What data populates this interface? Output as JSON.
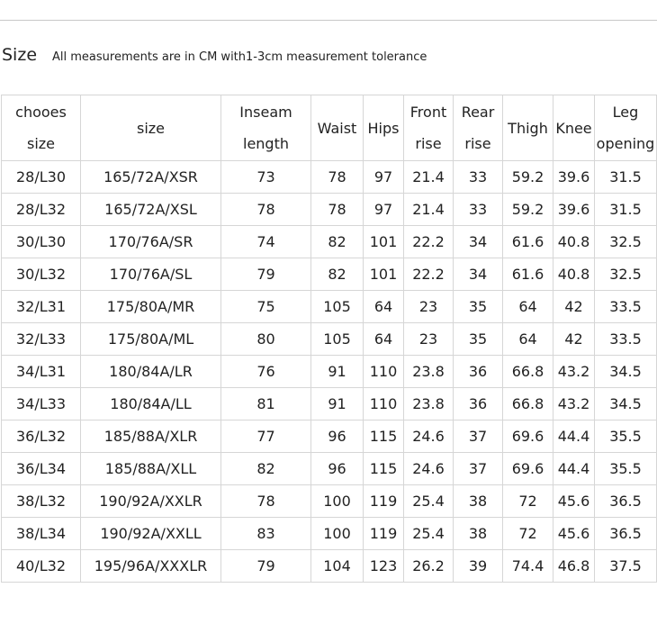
{
  "heading": {
    "title": "Size",
    "note": "All measurements are in CM with1-3cm measurement tolerance"
  },
  "table": {
    "headers": [
      {
        "lines": [
          "chooes",
          "size"
        ]
      },
      {
        "lines": [
          "size"
        ]
      },
      {
        "lines": [
          "Inseam",
          "length"
        ]
      },
      {
        "lines": [
          "Waist"
        ]
      },
      {
        "lines": [
          "Hips"
        ]
      },
      {
        "lines": [
          "Front",
          "rise"
        ]
      },
      {
        "lines": [
          "Rear",
          "rise"
        ]
      },
      {
        "lines": [
          "Thigh"
        ]
      },
      {
        "lines": [
          "Knee"
        ]
      },
      {
        "lines": [
          "Leg",
          "opening"
        ]
      }
    ],
    "rows": [
      [
        "28/L30",
        "165/72A/XSR",
        "73",
        "78",
        "97",
        "21.4",
        "33",
        "59.2",
        "39.6",
        "31.5"
      ],
      [
        "28/L32",
        "165/72A/XSL",
        "78",
        "78",
        "97",
        "21.4",
        "33",
        "59.2",
        "39.6",
        "31.5"
      ],
      [
        "30/L30",
        "170/76A/SR",
        "74",
        "82",
        "101",
        "22.2",
        "34",
        "61.6",
        "40.8",
        "32.5"
      ],
      [
        "30/L32",
        "170/76A/SL",
        "79",
        "82",
        "101",
        "22.2",
        "34",
        "61.6",
        "40.8",
        "32.5"
      ],
      [
        "32/L31",
        "175/80A/MR",
        "75",
        "105",
        "64",
        "23",
        "35",
        "64",
        "42",
        "33.5"
      ],
      [
        "32/L33",
        "175/80A/ML",
        "80",
        "105",
        "64",
        "23",
        "35",
        "64",
        "42",
        "33.5"
      ],
      [
        "34/L31",
        "180/84A/LR",
        "76",
        "91",
        "110",
        "23.8",
        "36",
        "66.8",
        "43.2",
        "34.5"
      ],
      [
        "34/L33",
        "180/84A/LL",
        "81",
        "91",
        "110",
        "23.8",
        "36",
        "66.8",
        "43.2",
        "34.5"
      ],
      [
        "36/L32",
        "185/88A/XLR",
        "77",
        "96",
        "115",
        "24.6",
        "37",
        "69.6",
        "44.4",
        "35.5"
      ],
      [
        "36/L34",
        "185/88A/XLL",
        "82",
        "96",
        "115",
        "24.6",
        "37",
        "69.6",
        "44.4",
        "35.5"
      ],
      [
        "38/L32",
        "190/92A/XXLR",
        "78",
        "100",
        "119",
        "25.4",
        "38",
        "72",
        "45.6",
        "36.5"
      ],
      [
        "38/L34",
        "190/92A/XXLL",
        "83",
        "100",
        "119",
        "25.4",
        "38",
        "72",
        "45.6",
        "36.5"
      ],
      [
        "40/L32",
        "195/96A/XXXLR",
        "79",
        "104",
        "123",
        "26.2",
        "39",
        "74.4",
        "46.8",
        "37.5"
      ]
    ]
  }
}
